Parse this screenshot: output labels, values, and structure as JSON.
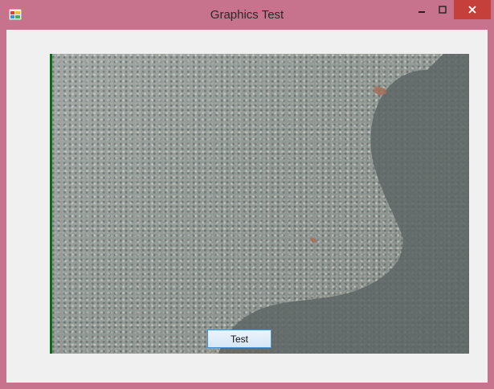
{
  "window": {
    "title": "Graphics Test",
    "icons": {
      "app": "app-icon",
      "minimize": "minimize-icon",
      "maximize": "maximize-icon",
      "close": "close-icon"
    },
    "colors": {
      "title_bar": "#c7738d",
      "client_background": "#f0f0f0",
      "close_button": "#c6403b"
    }
  },
  "picture": {
    "content": "gravel-photo-with-shadow"
  },
  "buttons": {
    "test_label": "Test"
  }
}
